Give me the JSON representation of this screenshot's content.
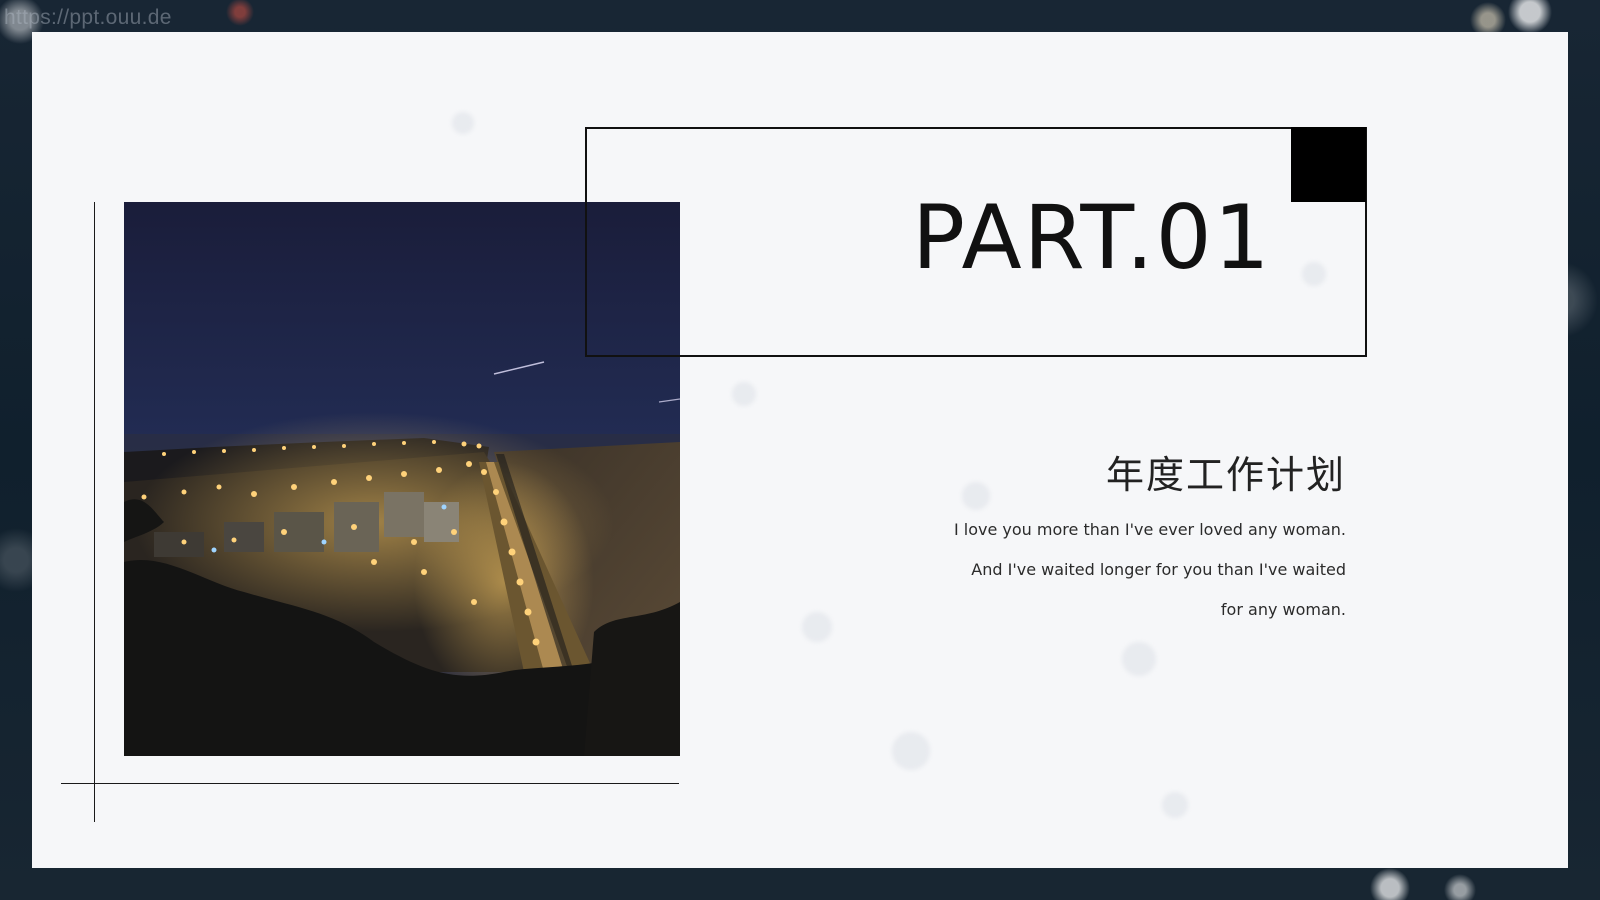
{
  "watermark": "https://ppt.ouu.de",
  "slide": {
    "part_label": "PART.01",
    "subtitle": "年度工作计划",
    "body_lines": [
      "I love you more than I've ever loved any woman.",
      "And I've waited longer for you than I've waited",
      "for any woman."
    ],
    "photo_alt": "night city coastline photo"
  },
  "colors": {
    "background_dark": "#14202b",
    "slide_panel": "#f6f7f9",
    "accent_black": "#000000",
    "text": "#222222"
  }
}
